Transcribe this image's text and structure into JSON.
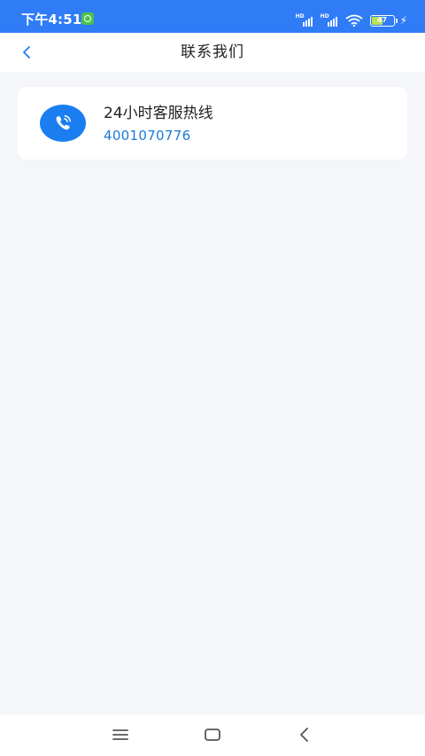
{
  "status_bar": {
    "time": "下午4:51",
    "battery_level": "47",
    "icons": [
      "app-notification-icon",
      "hd-signal-icon",
      "hd-signal-icon",
      "wifi-icon",
      "battery-icon",
      "charging-icon"
    ]
  },
  "header": {
    "title": "联系我们",
    "back_icon": "chevron-left-icon"
  },
  "contact_card": {
    "title": "24小时客服热线",
    "phone": "4001070776",
    "icon": "phone-icon"
  },
  "system_nav": {
    "buttons": [
      "menu-icon",
      "home-icon",
      "back-icon"
    ]
  },
  "colors": {
    "status_bar": "#2f7cf6",
    "accent": "#1a7ef0",
    "phone_text": "#1a7ad8",
    "page_background": "#f4f6fa"
  }
}
